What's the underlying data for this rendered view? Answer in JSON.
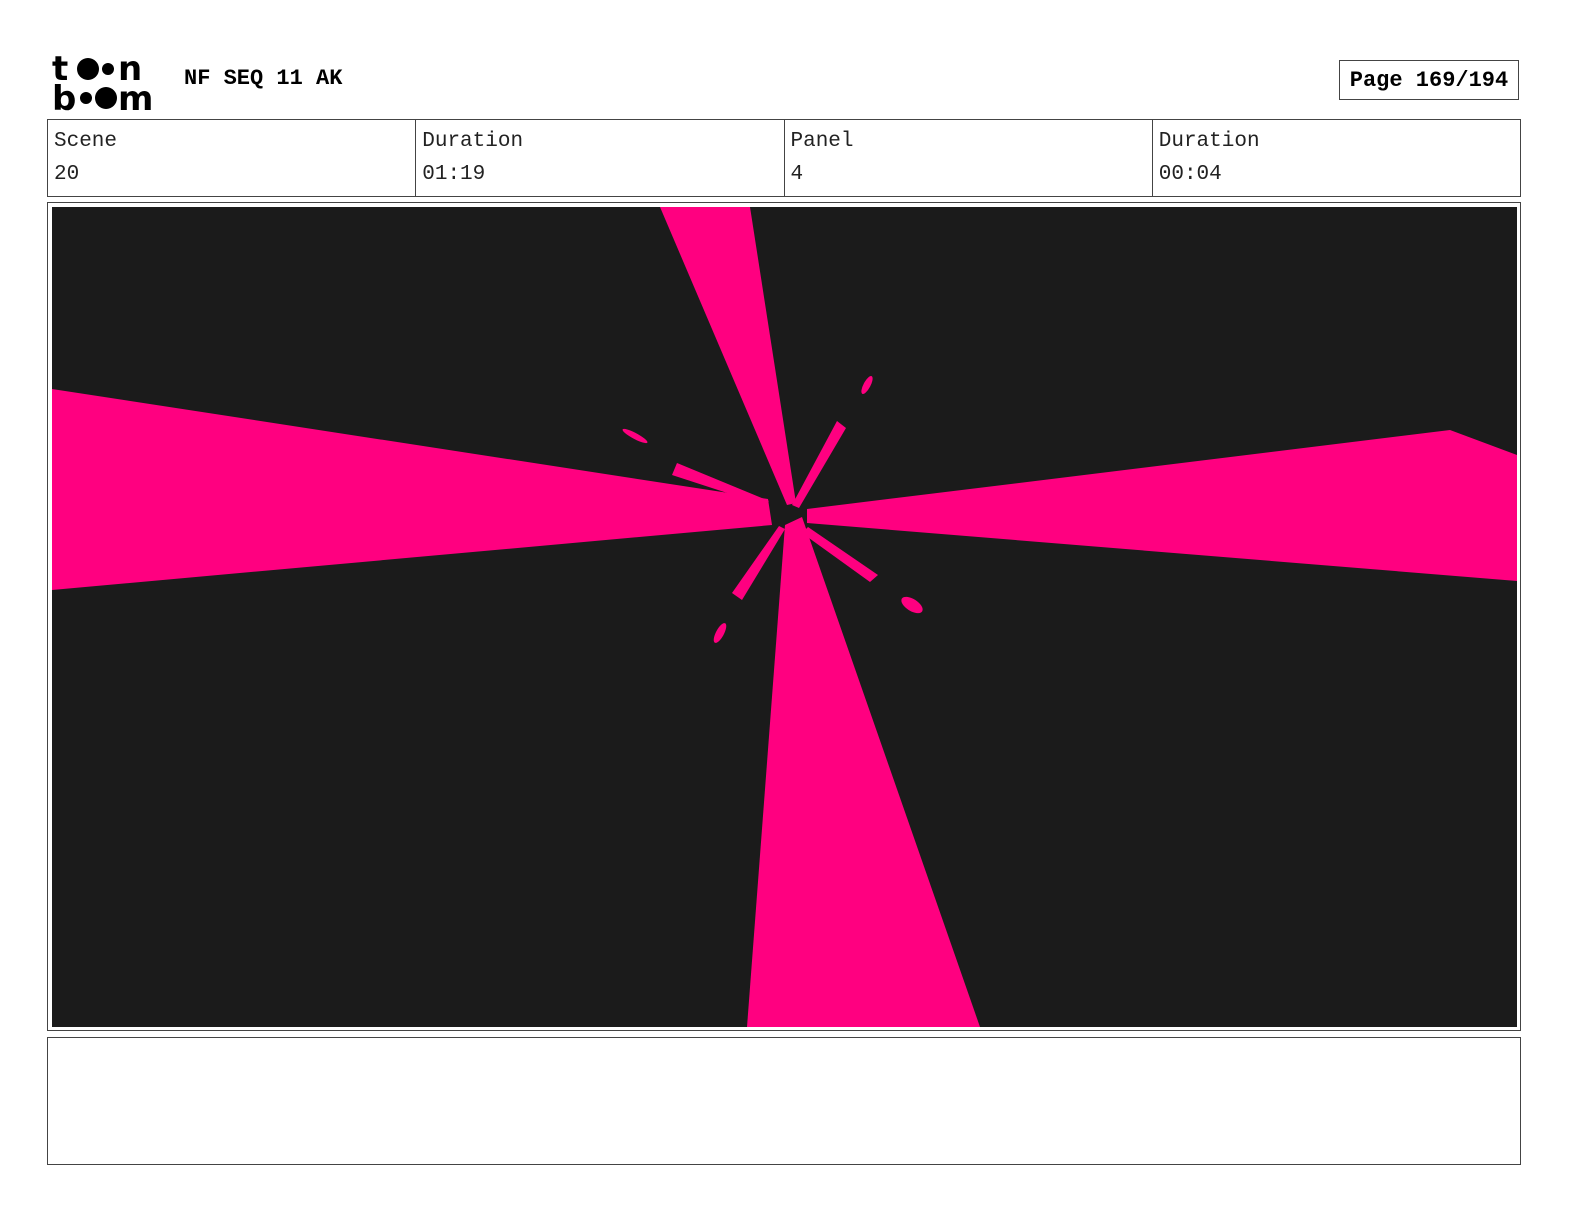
{
  "header": {
    "logo_text": "toon boom",
    "project_title": "NF SEQ 11 AK",
    "page_label": "Page 169/194"
  },
  "info": {
    "scene_label": "Scene",
    "scene_value": "20",
    "scene_duration_label": "Duration",
    "scene_duration_value": "01:19",
    "panel_label": "Panel",
    "panel_value": "4",
    "panel_duration_label": "Duration",
    "panel_duration_value": "00:04"
  },
  "panel": {
    "background_color": "#1b1b1b",
    "accent_color": "#ff0080"
  },
  "notes": {
    "text": ""
  }
}
